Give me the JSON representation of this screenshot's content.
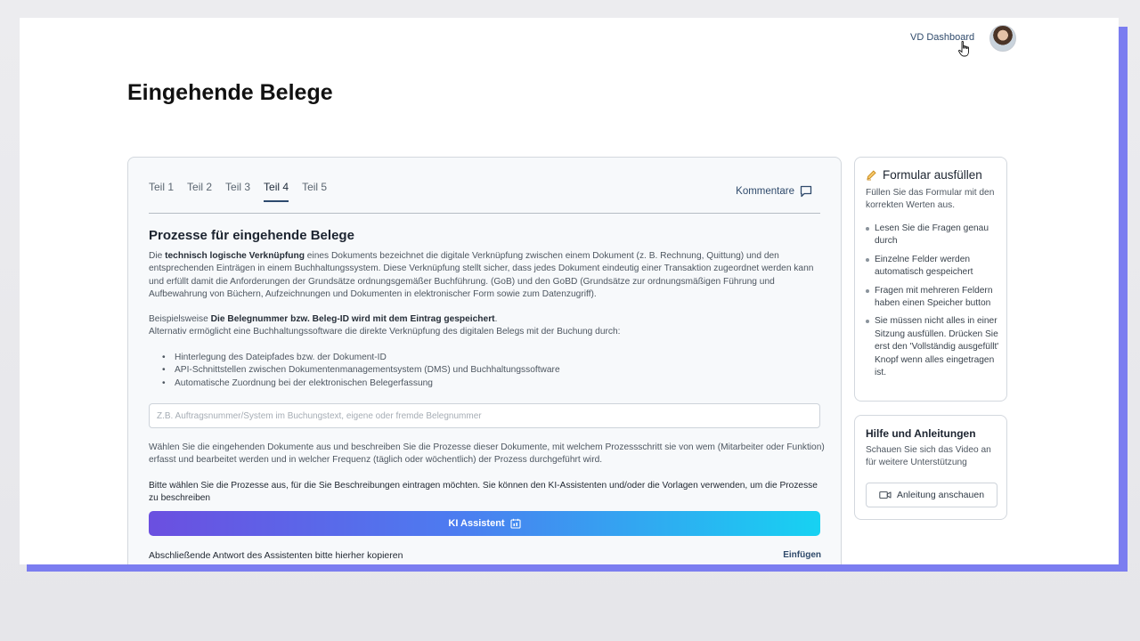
{
  "header": {
    "dashboard_link": "VD Dashboard",
    "page_title": "Eingehende Belege"
  },
  "tabs": [
    {
      "label": "Teil 1",
      "active": false
    },
    {
      "label": "Teil 2",
      "active": false
    },
    {
      "label": "Teil 3",
      "active": false
    },
    {
      "label": "Teil 4",
      "active": true
    },
    {
      "label": "Teil 5",
      "active": false
    }
  ],
  "comments_label": "Kommentare",
  "section": {
    "title": "Prozesse für eingehende Belege",
    "p1_pre": "Die ",
    "p1_bold": "technisch logische Verknüpfung",
    "p1_post": " eines Dokuments bezeichnet die digitale Verknüpfung zwischen einem Dokument (z. B. Rechnung, Quittung) und den entsprechenden Einträgen in einem Buchhaltungssystem. Diese Verknüpfung stellt sicher, dass jedes Dokument eindeutig einer Transaktion zugeordnet werden kann und erfüllt damit die Anforderungen der Grundsätze ordnungsgemäßer Buchführung. (GoB) und den GoBD (Grundsätze zur ordnungsmäßigen Führung und Aufbewahrung von Büchern, Aufzeichnungen und Dokumenten in elektronischer Form sowie zum Datenzugriff).",
    "p2_pre": "Beispielsweise ",
    "p2_bold": "Die Belegnummer bzw. Beleg-ID wird mit dem Eintrag gespeichert",
    "p2_dot": ".",
    "p2_line2": "Alternativ ermöglicht eine Buchhaltungssoftware die direkte Verknüpfung des digitalen Belegs mit der Buchung durch:",
    "bullets": [
      "Hinterlegung des Dateipfades bzw. der Dokument-ID",
      "API-Schnittstellen zwischen Dokumentenmanagementsystem (DMS) und Buchhaltungssoftware",
      "Automatische Zuordnung bei der elektronischen Belegerfassung"
    ],
    "input_placeholder": "Z.B. Auftragsnummer/System im Buchungstext, eigene oder fremde Belegnummer",
    "input_value": "",
    "p3": "Wählen Sie die eingehenden Dokumente aus und beschreiben Sie die Prozesse dieser Dokumente, mit welchem Prozessschritt sie von wem (Mitarbeiter oder Funktion) erfasst und bearbeitet werden und in welcher Frequenz (täglich oder wöchentlich) der Prozess durchgeführt wird.",
    "p4": "Bitte wählen Sie die Prozesse aus, für die Sie Beschreibungen eintragen möchten. Sie können den KI-Assistenten und/oder die Vorlagen verwenden, um die Prozesse zu beschreiben",
    "ki_button": "KI Assistent",
    "final_answer_label": "Abschließende Antwort des Assistenten bitte hierher kopieren",
    "paste_link": "Einfügen"
  },
  "form_card": {
    "title": "Formular ausfüllen",
    "subtitle": "Füllen Sie das Formular mit den korrekten Werten aus.",
    "tips": [
      "Lesen Sie die Fragen genau durch",
      "Einzelne Felder werden automatisch gespeichert",
      "Fragen mit mehreren Feldern haben einen Speicher button",
      "Sie müssen nicht alles in einer Sitzung ausfüllen. Drücken Sie erst den 'Vollständig ausgefüllt' Knopf wenn alles eingetragen ist."
    ]
  },
  "help_card": {
    "title": "Hilfe und Anleitungen",
    "subtitle": "Schauen Sie sich das Video an für weitere Unterstützung",
    "video_button": "Anleitung anschauen"
  },
  "icons": {
    "comment": "comment-icon",
    "pencil": "pencil-icon",
    "video": "video-icon",
    "calendar": "calendar-icon",
    "cursor": "pointer-cursor"
  },
  "colors": {
    "accent": "#2d4a6e",
    "gradient_start": "#6b4fe0",
    "gradient_end": "#17d2f2",
    "frame": "#7b7df0"
  }
}
